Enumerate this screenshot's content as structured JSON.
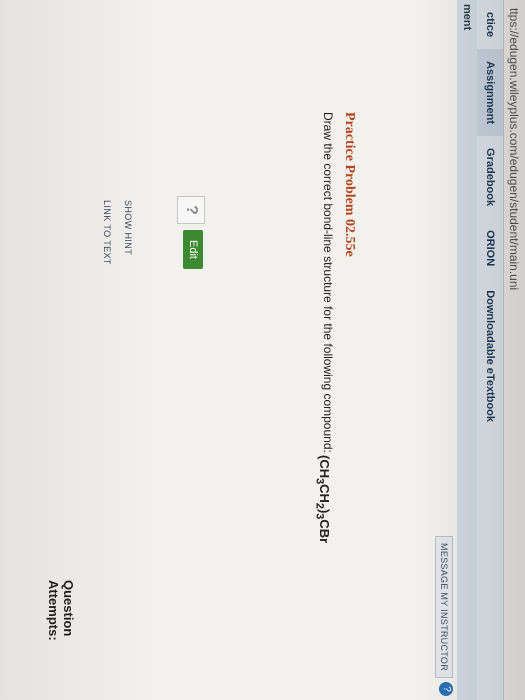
{
  "browser": {
    "url": "ttps://edugen.wileyplus.com/edugen/student/main.uni"
  },
  "nav": {
    "tabs": [
      "ctice",
      "Assignment",
      "Gradebook",
      "ORION",
      "Downloadable eTextbook"
    ],
    "active_index": 1
  },
  "section": {
    "label": "ment"
  },
  "toolbar": {
    "message_instructor": "MESSAGE MY INSTRUCTOR",
    "help": "?"
  },
  "problem": {
    "title": "Practice Problem 02.55e",
    "prompt": "Draw the correct bond-line structure for the following compound:",
    "formula_text": "(CH3CH2)3CBr"
  },
  "editor": {
    "placeholder_icon": "?",
    "edit_label": "Edit"
  },
  "links": {
    "show_hint": "SHOW HINT",
    "link_to_text": "LINK TO TEXT"
  },
  "footer": {
    "attempts_label": "Question Attempts:"
  },
  "colors": {
    "title": "#b4451f",
    "edit_button": "#3b8a2f",
    "help": "#2b6fb5"
  }
}
